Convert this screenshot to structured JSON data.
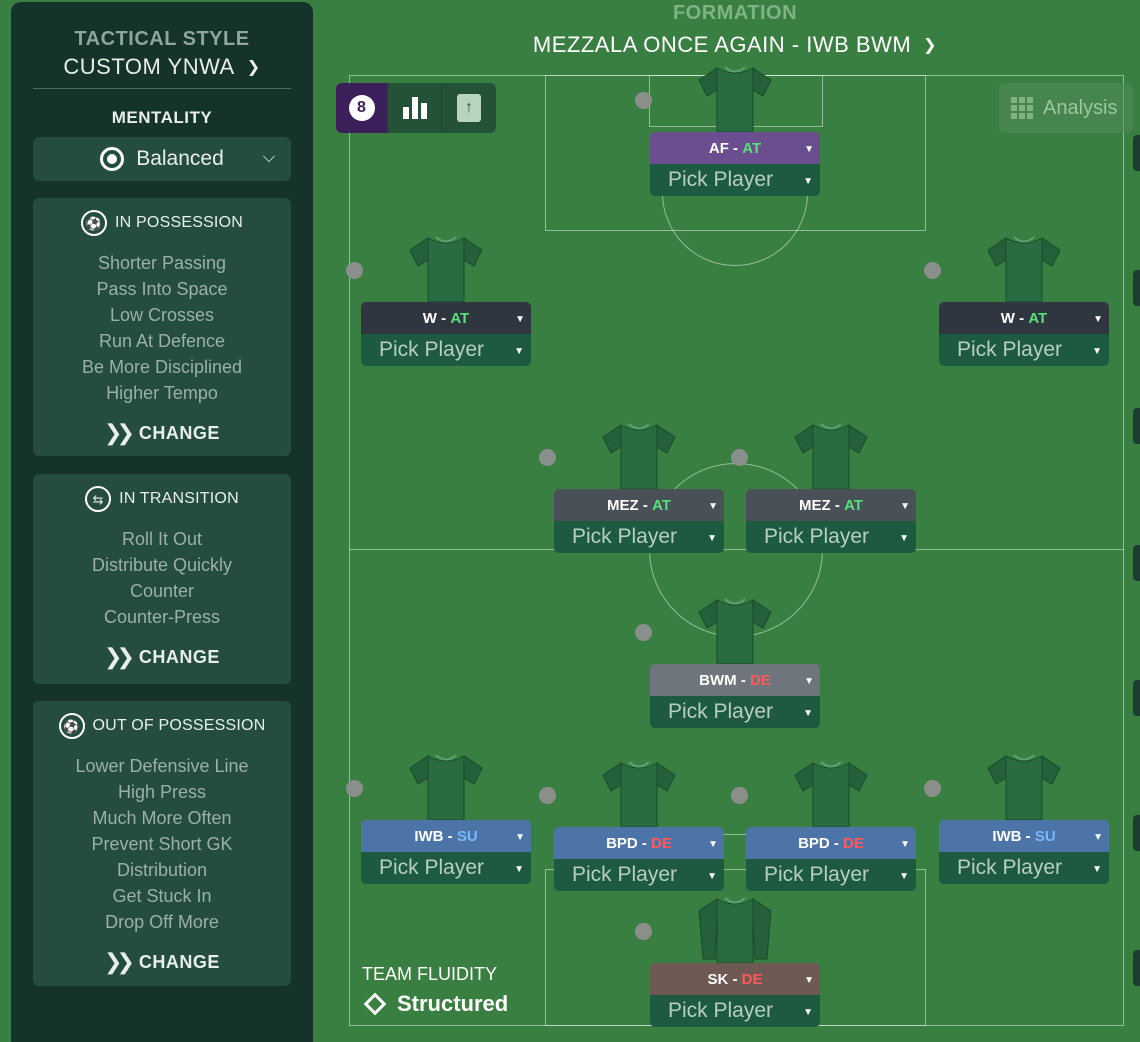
{
  "sidebar": {
    "tactical_style_label": "TACTICAL STYLE",
    "tactical_style_value": "CUSTOM YNWA",
    "mentality_label": "MENTALITY",
    "mentality_value": "Balanced",
    "panels": [
      {
        "title": "IN POSSESSION",
        "icon": "football-icon",
        "items": [
          "Shorter Passing",
          "Pass Into Space",
          "Low Crosses",
          "Run At Defence",
          "Be More Disciplined",
          "Higher Tempo"
        ],
        "change": "CHANGE"
      },
      {
        "title": "IN TRANSITION",
        "icon": "transition-cycle-icon",
        "items": [
          "Roll It Out",
          "Distribute Quickly",
          "Counter",
          "Counter-Press"
        ],
        "change": "CHANGE"
      },
      {
        "title": "OUT OF POSSESSION",
        "icon": "football-icon",
        "items": [
          "Lower Defensive Line",
          "High Press",
          "Much More Often",
          "Prevent Short GK",
          "Distribution",
          "Get Stuck In",
          "Drop Off More"
        ],
        "change": "CHANGE"
      }
    ]
  },
  "formation": {
    "label": "FORMATION",
    "value": "MEZZALA ONCE AGAIN - IWB BWM"
  },
  "toolbar": {
    "analysis_label": "Analysis",
    "player_badge": "8"
  },
  "pick_label": "Pick Player",
  "players": [
    {
      "role": "AF",
      "duty": "AT"
    },
    {
      "role": "W",
      "duty": "AT"
    },
    {
      "role": "W",
      "duty": "AT"
    },
    {
      "role": "MEZ",
      "duty": "AT"
    },
    {
      "role": "MEZ",
      "duty": "AT"
    },
    {
      "role": "BWM",
      "duty": "DE"
    },
    {
      "role": "IWB",
      "duty": "SU"
    },
    {
      "role": "BPD",
      "duty": "DE"
    },
    {
      "role": "BPD",
      "duty": "DE"
    },
    {
      "role": "IWB",
      "duty": "SU"
    },
    {
      "role": "SK",
      "duty": "DE"
    }
  ],
  "team_fluidity": {
    "label": "TEAM FLUIDITY",
    "value": "Structured"
  },
  "colors": {
    "pitch": "#3a7f42",
    "sidebar": "#15332a",
    "attack_duty": "#58e07a",
    "defend_duty": "#ff5a5a",
    "support_duty": "#79b8ff"
  }
}
